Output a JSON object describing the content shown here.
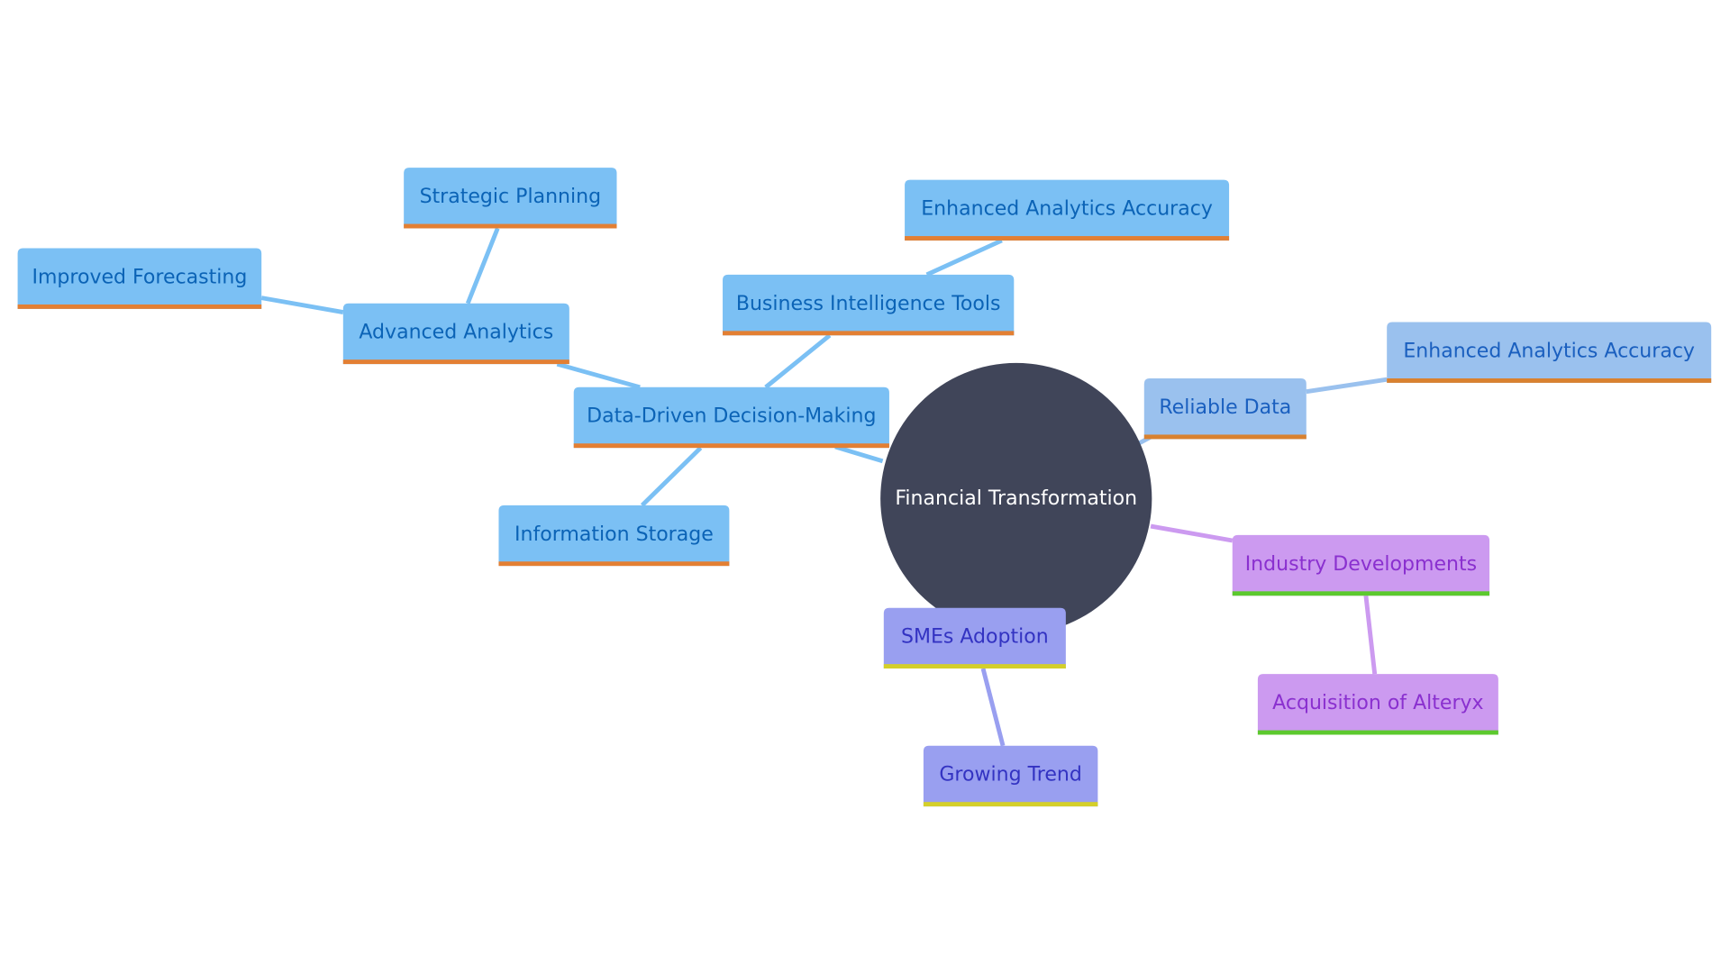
{
  "diagram": {
    "type": "mindmap",
    "root": {
      "id": "root",
      "label": "Financial Transformation"
    },
    "nodes": [
      {
        "id": "dddm",
        "label": "Data-Driven Decision-Making",
        "parent": "root",
        "theme": "blue"
      },
      {
        "id": "adv",
        "label": "Advanced Analytics",
        "parent": "dddm",
        "theme": "blue"
      },
      {
        "id": "strat",
        "label": "Strategic Planning",
        "parent": "adv",
        "theme": "blue"
      },
      {
        "id": "forecast",
        "label": "Improved Forecasting",
        "parent": "adv",
        "theme": "blue"
      },
      {
        "id": "bi",
        "label": "Business Intelligence Tools",
        "parent": "dddm",
        "theme": "blue"
      },
      {
        "id": "eaa1",
        "label": "Enhanced Analytics Accuracy",
        "parent": "bi",
        "theme": "blue"
      },
      {
        "id": "info",
        "label": "Information Storage",
        "parent": "dddm",
        "theme": "blue"
      },
      {
        "id": "reliable",
        "label": "Reliable Data",
        "parent": "root",
        "theme": "lightblue"
      },
      {
        "id": "eaa2",
        "label": "Enhanced Analytics Accuracy",
        "parent": "reliable",
        "theme": "lightblue"
      },
      {
        "id": "industry",
        "label": "Industry Developments",
        "parent": "root",
        "theme": "purple"
      },
      {
        "id": "alteryx",
        "label": "Acquisition of Alteryx",
        "parent": "industry",
        "theme": "purple"
      },
      {
        "id": "smes",
        "label": "SMEs Adoption",
        "parent": "root",
        "theme": "indigo"
      },
      {
        "id": "trend",
        "label": "Growing Trend",
        "parent": "smes",
        "theme": "indigo"
      }
    ]
  },
  "colors": {
    "root_fill": "#404559",
    "root_text": "#ffffff",
    "themes": {
      "blue": {
        "fill": "#7bc0f4",
        "text": "#0b63b6",
        "border": "#e37f33",
        "edge": "#7bc0f4"
      },
      "lightblue": {
        "fill": "#9ac1ee",
        "text": "#1a5fbf",
        "border": "#d9812f",
        "edge": "#9ac1ee"
      },
      "purple": {
        "fill": "#cc9af0",
        "text": "#8a30cf",
        "border": "#5cc92e",
        "edge": "#cc9af0"
      },
      "indigo": {
        "fill": "#999ff0",
        "text": "#3333c2",
        "border": "#d4cf2a",
        "edge": "#999ff0"
      }
    }
  }
}
